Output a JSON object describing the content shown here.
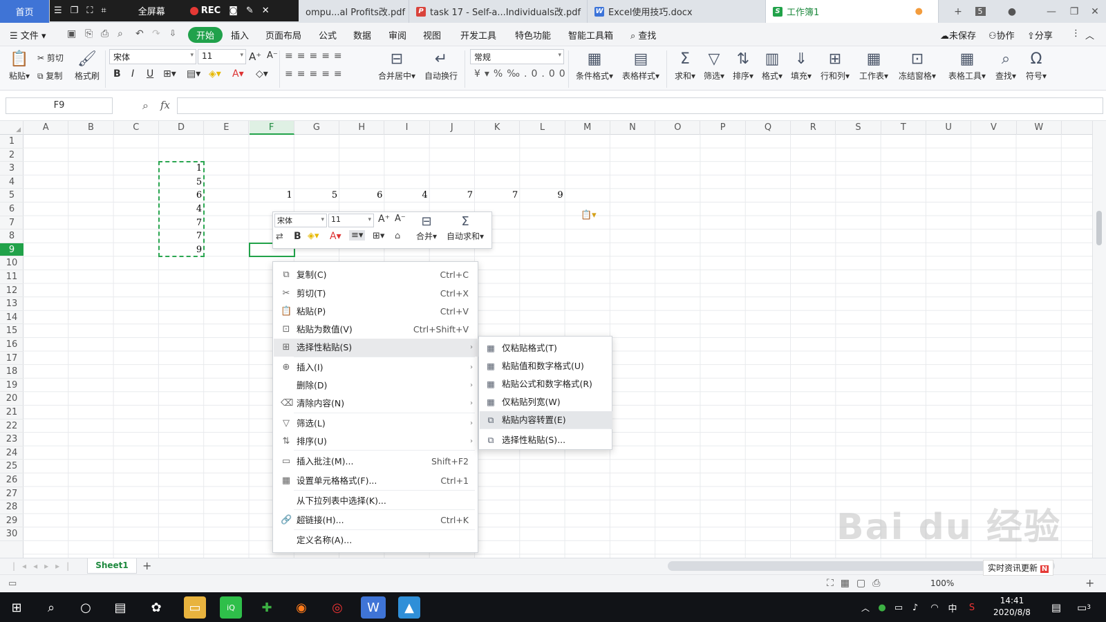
{
  "tabs": {
    "home": "首页",
    "recorder": {
      "fullscreen": "全屏幕",
      "rec": "REC"
    },
    "doc1": "ompu...al Profits改.pdf",
    "doc2": "task 17 - Self-a...Individuals改.pdf",
    "doc3": "Excel使用技巧.docx",
    "doc4": "工作簿1",
    "count": "5"
  },
  "menubar": {
    "file": "文件",
    "items": [
      "开始",
      "插入",
      "页面布局",
      "公式",
      "数据",
      "审阅",
      "视图",
      "开发工具",
      "特色功能",
      "智能工具箱"
    ],
    "search": "查找",
    "unsaved": "未保存",
    "collab": "协作",
    "share": "分享"
  },
  "ribbon": {
    "paste": "粘贴",
    "cut": "剪切",
    "copy": "复制",
    "format_painter": "格式刷",
    "font": "宋体",
    "size": "11",
    "merge": "合并居中",
    "wrap": "自动换行",
    "numfmt": "常规",
    "cond_format": "条件格式",
    "table_style": "表格样式",
    "sum": "求和",
    "filter": "筛选",
    "sort": "排序",
    "format": "格式",
    "fill": "填充",
    "rowcol": "行和列",
    "worksheet": "工作表",
    "freeze": "冻结窗格",
    "table_tools": "表格工具",
    "find": "查找",
    "symbol": "符号"
  },
  "formula_bar": {
    "name_box": "F9",
    "fx": "fx",
    "value": ""
  },
  "grid": {
    "columns": [
      "A",
      "B",
      "C",
      "D",
      "E",
      "F",
      "G",
      "H",
      "I",
      "J",
      "K",
      "L",
      "M",
      "N",
      "O",
      "P",
      "Q",
      "R",
      "S",
      "T",
      "U",
      "V",
      "W"
    ],
    "selected_col": "F",
    "rows": [
      "1",
      "2",
      "3",
      "4",
      "5",
      "6",
      "7",
      "8",
      "9",
      "10",
      "11",
      "12",
      "13",
      "14",
      "15",
      "16",
      "17",
      "18",
      "19",
      "20",
      "21",
      "22",
      "23",
      "24",
      "25",
      "26",
      "27",
      "28",
      "29",
      "30"
    ],
    "selected_row": "9",
    "col_d_values": [
      "1",
      "5",
      "6",
      "4",
      "7",
      "7",
      "9"
    ],
    "row5_values": [
      "1",
      "5",
      "6",
      "4",
      "7",
      "7",
      "9"
    ]
  },
  "mini_toolbar": {
    "font": "宋体",
    "size": "11",
    "merge": "合并",
    "autosum": "自动求和"
  },
  "context_menu": [
    {
      "label": "复制(C)",
      "shortcut": "Ctrl+C",
      "icon": "copy-icon",
      "glyph": "⧉"
    },
    {
      "label": "剪切(T)",
      "shortcut": "Ctrl+X",
      "icon": "scissors-icon",
      "glyph": "✂"
    },
    {
      "label": "粘贴(P)",
      "shortcut": "Ctrl+V",
      "icon": "paste-icon",
      "glyph": "📋"
    },
    {
      "label": "粘贴为数值(V)",
      "shortcut": "Ctrl+Shift+V",
      "icon": "paste-values-icon",
      "glyph": "⊡"
    },
    {
      "label": "选择性粘贴(S)",
      "shortcut": "",
      "icon": "paste-special-icon",
      "glyph": "⊞",
      "submenu": true
    },
    {
      "label": "插入(I)",
      "shortcut": "",
      "icon": "insert-icon",
      "glyph": "⊕",
      "submenu": true
    },
    {
      "label": "删除(D)",
      "shortcut": "",
      "icon": "",
      "glyph": "",
      "submenu": true
    },
    {
      "label": "清除内容(N)",
      "shortcut": "",
      "icon": "eraser-icon",
      "glyph": "⌫",
      "submenu": true
    },
    {
      "label": "筛选(L)",
      "shortcut": "",
      "icon": "filter-icon",
      "glyph": "▽",
      "submenu": true
    },
    {
      "label": "排序(U)",
      "shortcut": "",
      "icon": "sort-icon",
      "glyph": "⇅",
      "submenu": true
    },
    {
      "label": "插入批注(M)...",
      "shortcut": "Shift+F2",
      "icon": "comment-icon",
      "glyph": "▭"
    },
    {
      "label": "设置单元格格式(F)...",
      "shortcut": "Ctrl+1",
      "icon": "format-cells-icon",
      "glyph": "▦"
    },
    {
      "label": "从下拉列表中选择(K)...",
      "shortcut": "",
      "icon": "",
      "glyph": ""
    },
    {
      "label": "超链接(H)...",
      "shortcut": "Ctrl+K",
      "icon": "link-icon",
      "glyph": "🔗"
    },
    {
      "label": "定义名称(A)...",
      "shortcut": "",
      "icon": "",
      "glyph": ""
    }
  ],
  "submenu": [
    {
      "label": "仅粘贴格式(T)",
      "icon": "paste-format-icon"
    },
    {
      "label": "粘贴值和数字格式(U)",
      "icon": "paste-value-number-icon"
    },
    {
      "label": "粘贴公式和数字格式(R)",
      "icon": "paste-formula-icon"
    },
    {
      "label": "仅粘贴列宽(W)",
      "icon": "paste-colwidth-icon"
    },
    {
      "label": "粘贴内容转置(E)",
      "icon": "paste-transpose-icon"
    },
    {
      "label": "选择性粘贴(S)...",
      "icon": "paste-special-icon"
    }
  ],
  "sheet": {
    "name": "Sheet1",
    "add": "+"
  },
  "status": {
    "news": "实时资讯更新",
    "zoom": "100%"
  },
  "taskbar": {
    "time": "14:41",
    "date": "2020/8/8",
    "ime": "中",
    "notif": "3"
  },
  "watermark": "Bai du 经验",
  "colors": {
    "accent": "#21a249",
    "tab_blue": "#3f74d6",
    "selection": "#2aa650"
  }
}
